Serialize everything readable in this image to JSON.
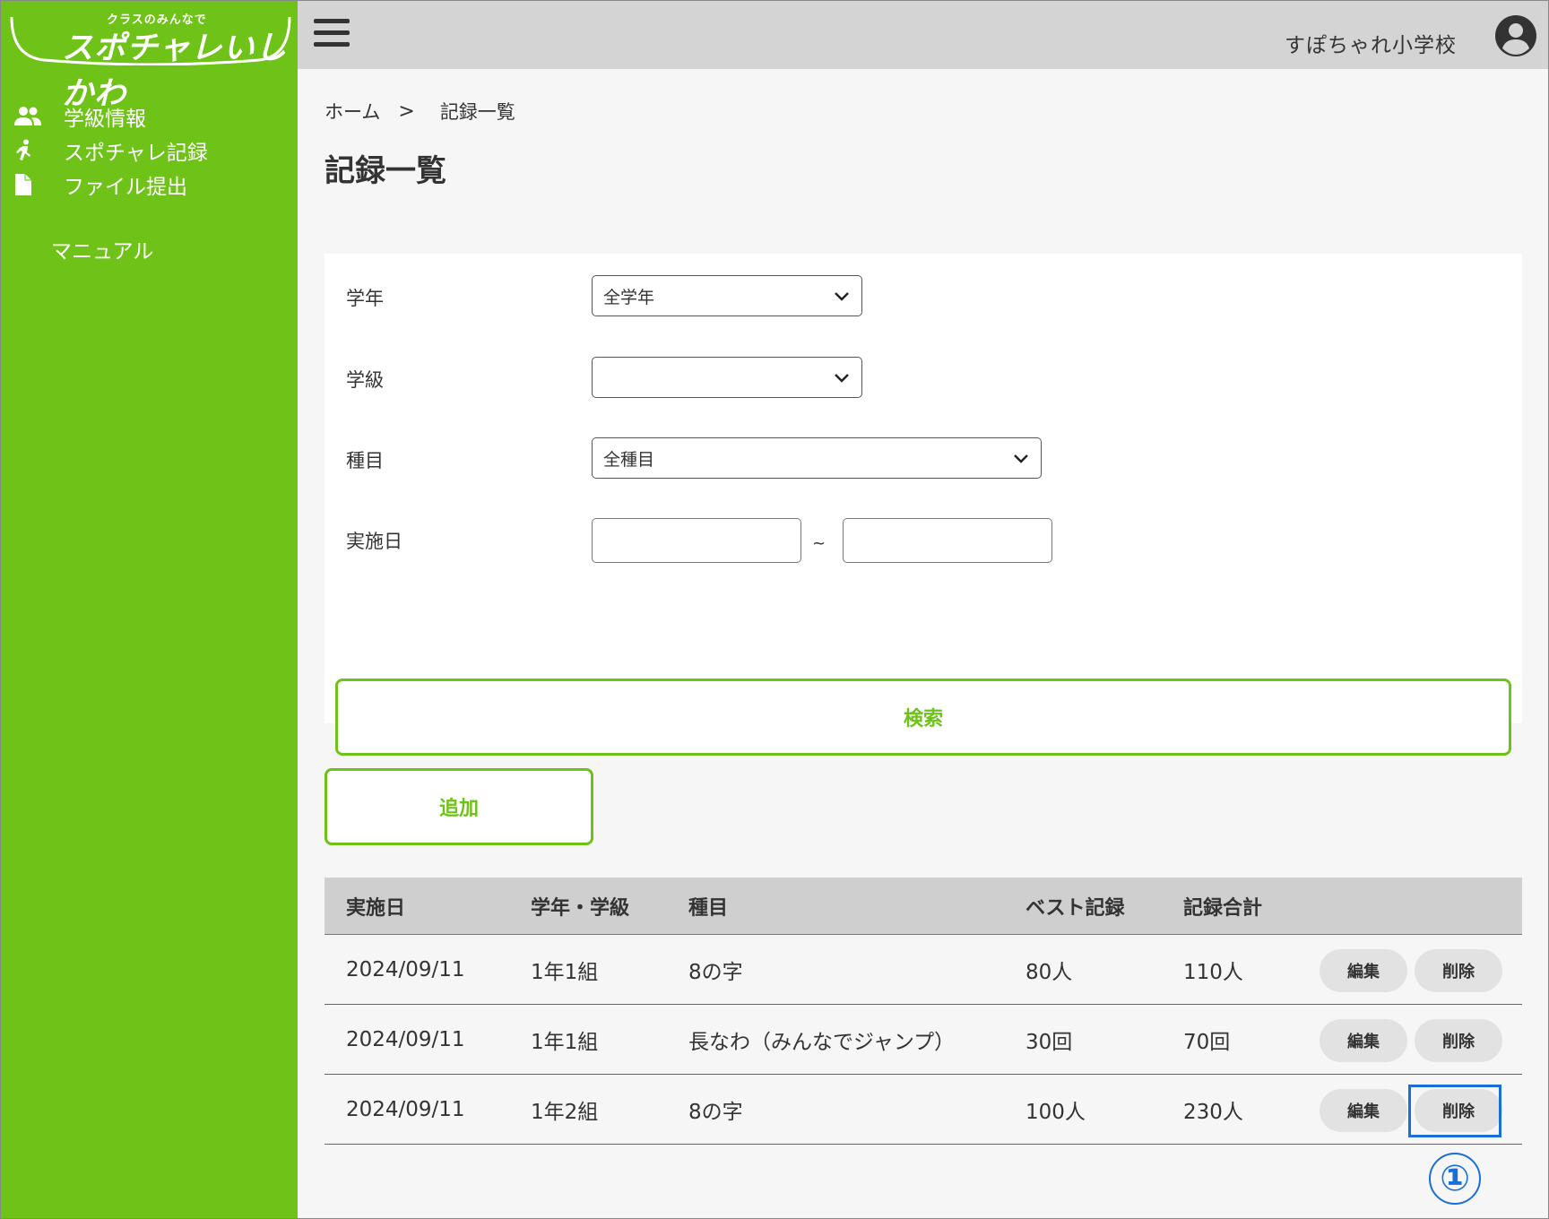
{
  "app": {
    "logo_sub": "クラスのみんなで",
    "logo_main": "スポチャレいしかわ",
    "accent_color": "#6ec218",
    "annotation_color": "#1a6fd6"
  },
  "sidebar": {
    "items": [
      {
        "label": "学級情報",
        "icon": "users-icon"
      },
      {
        "label": "スポチャレ記録",
        "icon": "runner-icon"
      },
      {
        "label": "ファイル提出",
        "icon": "file-icon"
      },
      {
        "label": "マニュアル",
        "icon": ""
      }
    ]
  },
  "header": {
    "school_name": "すぽちゃれ小学校",
    "menu_icon": "hamburger-icon",
    "account_icon": "user-circle-icon"
  },
  "breadcrumb": {
    "home": "ホーム",
    "separator": ">",
    "current": "記録一覧"
  },
  "page": {
    "title": "記録一覧"
  },
  "search": {
    "grade_label": "学年",
    "grade_value": "全学年",
    "class_label": "学級",
    "class_value": "",
    "event_label": "種目",
    "event_value": "全種目",
    "date_label": "実施日",
    "date_from": "",
    "date_to": "",
    "date_separator": "~",
    "search_button": "検索"
  },
  "actions": {
    "add_button": "追加"
  },
  "table": {
    "headers": [
      "実施日",
      "学年・学級",
      "種目",
      "ベスト記録",
      "記録合計"
    ],
    "rows": [
      {
        "date": "2024/09/11",
        "class": "1年1組",
        "event": "8の字",
        "best": "80人",
        "total": "110人",
        "edit": "編集",
        "delete": "削除"
      },
      {
        "date": "2024/09/11",
        "class": "1年1組",
        "event": "長なわ（みんなでジャンプ）",
        "best": "30回",
        "total": "70回",
        "edit": "編集",
        "delete": "削除"
      },
      {
        "date": "2024/09/11",
        "class": "1年2組",
        "event": "8の字",
        "best": "100人",
        "total": "230人",
        "edit": "編集",
        "delete": "削除"
      }
    ]
  },
  "annotation": {
    "step_marker": "①"
  }
}
